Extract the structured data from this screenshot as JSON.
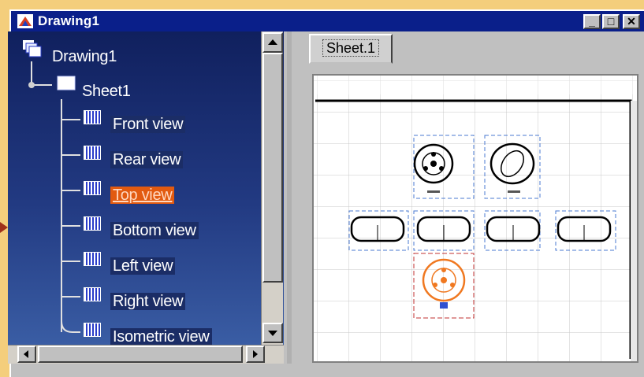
{
  "window": {
    "title": "Drawing1",
    "controls": {
      "minimize": "_",
      "maximize": "□",
      "close": "✕"
    }
  },
  "tree": {
    "root": {
      "label": "Drawing1",
      "icon": "drawing-icon"
    },
    "sheet": {
      "label": "Sheet1",
      "icon": "sheet-icon"
    },
    "views": [
      {
        "label": "Front view",
        "icon": "view-icon",
        "selected": false
      },
      {
        "label": "Rear view",
        "icon": "view-icon",
        "selected": false
      },
      {
        "label": "Top view",
        "icon": "view-icon",
        "selected": true
      },
      {
        "label": "Bottom view",
        "icon": "view-icon",
        "selected": false
      },
      {
        "label": "Left view",
        "icon": "view-icon",
        "selected": false
      },
      {
        "label": "Right view",
        "icon": "view-icon",
        "selected": false
      },
      {
        "label": "Isometric view",
        "icon": "view-icon",
        "selected": false
      }
    ]
  },
  "sheet_tabs": [
    {
      "label": "Sheet.1",
      "active": true
    }
  ],
  "colors": {
    "title_bar": "#0a1f8a",
    "tree_background_top": "#10205e",
    "tree_background_bottom": "#3a5da4",
    "selection_highlight": "#e25a10",
    "view_frame": "#4a78d0",
    "active_view_frame": "#c03030",
    "active_view_stroke": "#f07820",
    "desktop_background": "#f4ce7c"
  }
}
